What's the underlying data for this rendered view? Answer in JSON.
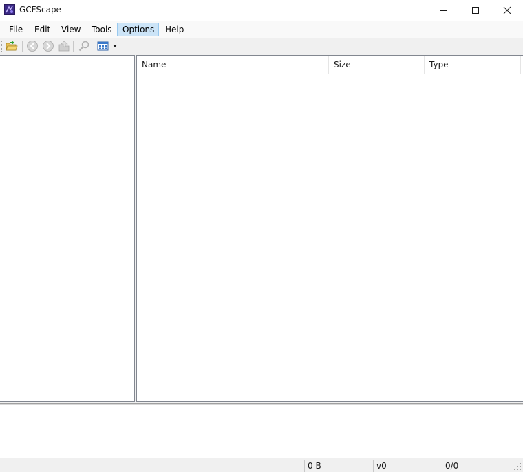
{
  "window": {
    "title": "GCFScape"
  },
  "menu": [
    {
      "label": "File"
    },
    {
      "label": "Edit"
    },
    {
      "label": "View"
    },
    {
      "label": "Tools"
    },
    {
      "label": "Options",
      "active": true
    },
    {
      "label": "Help"
    }
  ],
  "toolbar": {
    "buttons": [
      {
        "icon": "open-folder-icon",
        "enabled": true
      },
      {
        "icon": "back-icon",
        "enabled": false
      },
      {
        "icon": "forward-icon",
        "enabled": false
      },
      {
        "icon": "up-icon",
        "enabled": false
      },
      {
        "icon": "find-icon",
        "enabled": false
      },
      {
        "icon": "view-mode-icon",
        "enabled": true
      }
    ]
  },
  "list": {
    "columns": [
      {
        "label": "Name"
      },
      {
        "label": "Size"
      },
      {
        "label": "Type"
      }
    ]
  },
  "status": {
    "size": "0 B",
    "version": "v0",
    "count": "0/0"
  },
  "colors": {
    "menu_active_bg": "#cce4f7",
    "menu_active_border": "#99c9ef",
    "pane_border": "#828790"
  }
}
